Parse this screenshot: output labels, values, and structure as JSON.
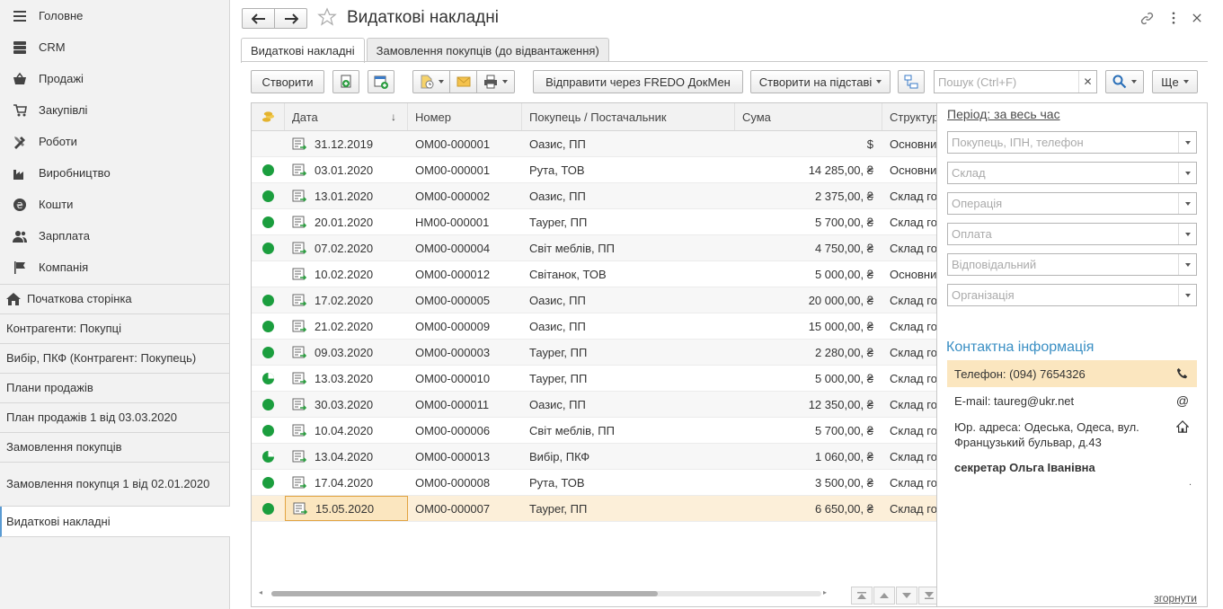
{
  "sidebar": {
    "sections": [
      {
        "label": "Головне",
        "icon": "menu-icon"
      },
      {
        "label": "CRM",
        "icon": "crm-icon"
      },
      {
        "label": "Продажі",
        "icon": "basket-icon"
      },
      {
        "label": "Закупівлі",
        "icon": "cart-icon"
      },
      {
        "label": "Роботи",
        "icon": "tools-icon"
      },
      {
        "label": "Виробництво",
        "icon": "factory-icon"
      },
      {
        "label": "Кошти",
        "icon": "coin-icon"
      },
      {
        "label": "Зарплата",
        "icon": "people-icon"
      },
      {
        "label": "Компанія",
        "icon": "flag-icon"
      }
    ],
    "open_windows": [
      "Початкова сторінка",
      "Контрагенти: Покупці",
      "Вибір, ПКФ (Контрагент: Покупець)",
      "Плани продажів",
      "План продажів 1 від 03.03.2020",
      "Замовлення покупців",
      "Замовлення покупця 1 від 02.01.2020",
      "Видаткові накладні"
    ]
  },
  "header": {
    "title": "Видаткові накладні"
  },
  "tabs": [
    "Видаткові накладні",
    "Замовлення покупців (до відвантаження)"
  ],
  "toolbar": {
    "create": "Створити",
    "send_fredo": "Відправити через FREDO ДокМен",
    "create_based": "Створити на підставі",
    "search_placeholder": "Пошук (Ctrl+F)",
    "more": "Ще"
  },
  "table": {
    "columns": [
      "Дата",
      "Номер",
      "Покупець / Постачальник",
      "Сума",
      "Структур"
    ],
    "rows": [
      {
        "status": "none",
        "date": "31.12.2019",
        "number": "ОМ00-000001",
        "partner": "Оазис, ПП",
        "sum": "$",
        "struct": "Основни"
      },
      {
        "status": "full",
        "date": "03.01.2020",
        "number": "ОМ00-000001",
        "partner": "Рута, ТОВ",
        "sum": "14 285,00, ₴",
        "struct": "Основни"
      },
      {
        "status": "full",
        "date": "13.01.2020",
        "number": "ОМ00-000002",
        "partner": "Оазис, ПП",
        "sum": "2 375,00, ₴",
        "struct": "Склад го"
      },
      {
        "status": "full",
        "date": "20.01.2020",
        "number": "НМ00-000001",
        "partner": "Таурег, ПП",
        "sum": "5 700,00, ₴",
        "struct": "Склад го"
      },
      {
        "status": "full",
        "date": "07.02.2020",
        "number": "ОМ00-000004",
        "partner": "Світ меблів, ПП",
        "sum": "4 750,00, ₴",
        "struct": "Склад го"
      },
      {
        "status": "none",
        "date": "10.02.2020",
        "number": "ОМ00-000012",
        "partner": "Світанок, ТОВ",
        "sum": "5 000,00, ₴",
        "struct": "Основни"
      },
      {
        "status": "full",
        "date": "17.02.2020",
        "number": "ОМ00-000005",
        "partner": "Оазис, ПП",
        "sum": "20 000,00, ₴",
        "struct": "Склад го"
      },
      {
        "status": "full",
        "date": "21.02.2020",
        "number": "ОМ00-000009",
        "partner": "Оазис, ПП",
        "sum": "15 000,00, ₴",
        "struct": "Склад го"
      },
      {
        "status": "full",
        "date": "09.03.2020",
        "number": "ОМ00-000003",
        "partner": "Таурег, ПП",
        "sum": "2 280,00, ₴",
        "struct": "Склад го"
      },
      {
        "status": "partial",
        "date": "13.03.2020",
        "number": "ОМ00-000010",
        "partner": "Таурег, ПП",
        "sum": "5 000,00, ₴",
        "struct": "Склад го"
      },
      {
        "status": "full",
        "date": "30.03.2020",
        "number": "ОМ00-000011",
        "partner": "Оазис, ПП",
        "sum": "12 350,00, ₴",
        "struct": "Склад го"
      },
      {
        "status": "full",
        "date": "10.04.2020",
        "number": "ОМ00-000006",
        "partner": "Світ меблів, ПП",
        "sum": "5 700,00, ₴",
        "struct": "Склад го"
      },
      {
        "status": "partial",
        "date": "13.04.2020",
        "number": "ОМ00-000013",
        "partner": "Вибір, ПКФ",
        "sum": "1 060,00, ₴",
        "struct": "Склад го"
      },
      {
        "status": "full",
        "date": "17.04.2020",
        "number": "ОМ00-000008",
        "partner": "Рута, ТОВ",
        "sum": "3 500,00, ₴",
        "struct": "Склад го"
      },
      {
        "status": "full",
        "date": "15.05.2020",
        "number": "ОМ00-000007",
        "partner": "Таурег, ПП",
        "sum": "6 650,00, ₴",
        "struct": "Склад го"
      }
    ],
    "selected_row": 14
  },
  "filters": {
    "period": "Період: за весь час",
    "fields": [
      "Покупець, ІПН, телефон",
      "Склад",
      "Операція",
      "Оплата",
      "Відповідальний",
      "Організація"
    ]
  },
  "contact": {
    "title": "Контактна інформація",
    "phone": "Телефон: (094) 7654326",
    "email": "E-mail: taureg@ukr.net",
    "address": "Юр. адреса: Одеська, Одеса, вул. Французький бульвар, д.43",
    "person": "секретар Ольга Іванівна",
    "dot": "."
  },
  "collapse": "згорнути",
  "colors": {
    "status_green": "#1b9e3e",
    "selected_row": "#fcefd9",
    "accent_blue": "#3a8fc4"
  }
}
